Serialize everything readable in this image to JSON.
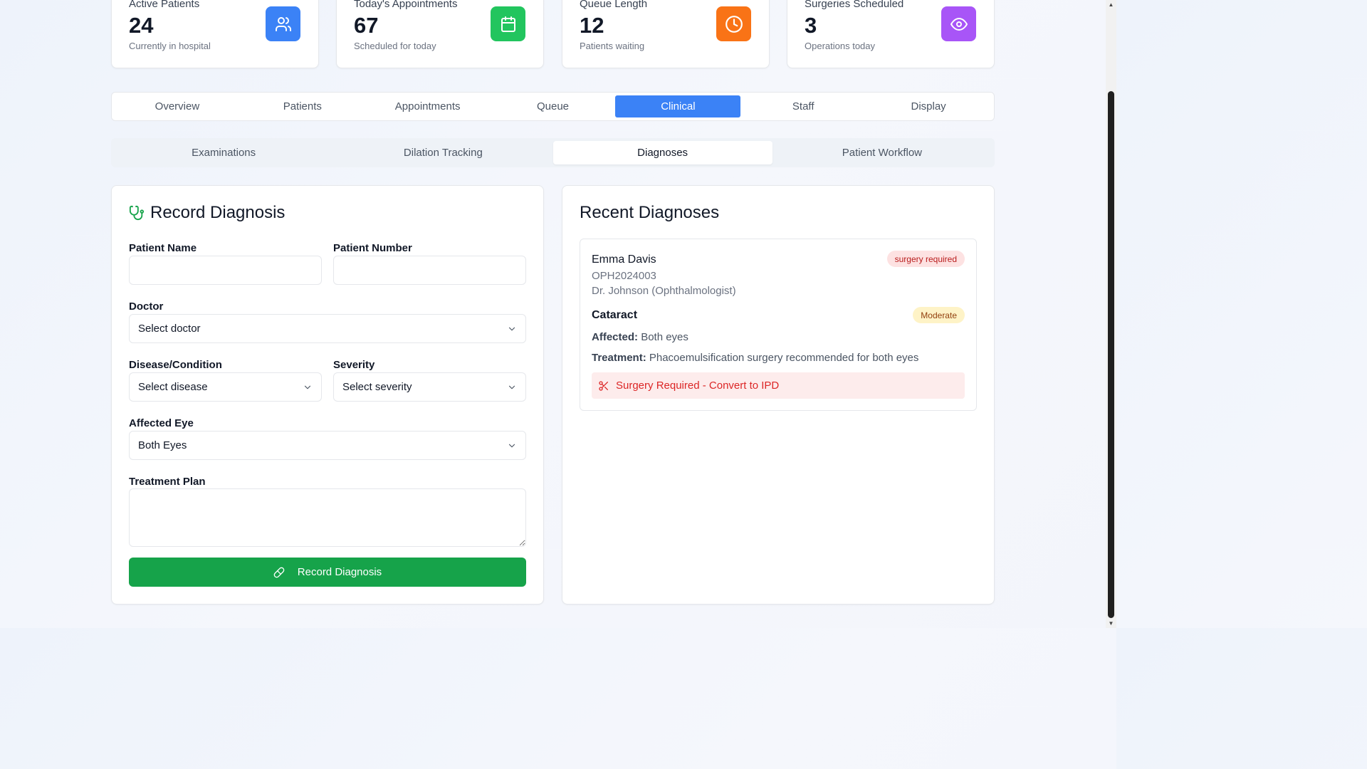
{
  "stats": [
    {
      "title": "Active Patients",
      "value": "24",
      "subtitle": "Currently in hospital",
      "icon": "users-icon",
      "color": "#3b82f6"
    },
    {
      "title": "Today's Appointments",
      "value": "67",
      "subtitle": "Scheduled for today",
      "icon": "calendar-icon",
      "color": "#22c55e"
    },
    {
      "title": "Queue Length",
      "value": "12",
      "subtitle": "Patients waiting",
      "icon": "clock-icon",
      "color": "#f97316"
    },
    {
      "title": "Surgeries Scheduled",
      "value": "3",
      "subtitle": "Operations today",
      "icon": "eye-icon",
      "color": "#a855f7"
    }
  ],
  "main_tabs": [
    "Overview",
    "Patients",
    "Appointments",
    "Queue",
    "Clinical",
    "Staff",
    "Display"
  ],
  "main_tab_active": "Clinical",
  "sub_tabs": [
    "Examinations",
    "Dilation Tracking",
    "Diagnoses",
    "Patient Workflow"
  ],
  "sub_tab_active": "Diagnoses",
  "form": {
    "heading": "Record Diagnosis",
    "patient_name_label": "Patient Name",
    "patient_name_value": "",
    "patient_number_label": "Patient Number",
    "patient_number_value": "",
    "doctor_label": "Doctor",
    "doctor_value": "Select doctor",
    "disease_label": "Disease/Condition",
    "disease_value": "Select disease",
    "severity_label": "Severity",
    "severity_value": "Select severity",
    "eye_label": "Affected Eye",
    "eye_value": "Both Eyes",
    "treatment_label": "Treatment Plan",
    "treatment_value": "",
    "submit_label": "Record Diagnosis",
    "accent": "#16a34a"
  },
  "recent": {
    "heading": "Recent Diagnoses",
    "items": [
      {
        "patient": "Emma Davis",
        "number": "OPH2024003",
        "doctor": "Dr. Johnson (Ophthalmologist)",
        "status_badge": "surgery required",
        "condition": "Cataract",
        "severity": "Moderate",
        "affected_label": "Affected:",
        "affected_value": "Both eyes",
        "treatment_label": "Treatment:",
        "treatment_value": "Phacoemulsification surgery recommended for both eyes",
        "alert": "Surgery Required - Convert to IPD"
      }
    ]
  }
}
